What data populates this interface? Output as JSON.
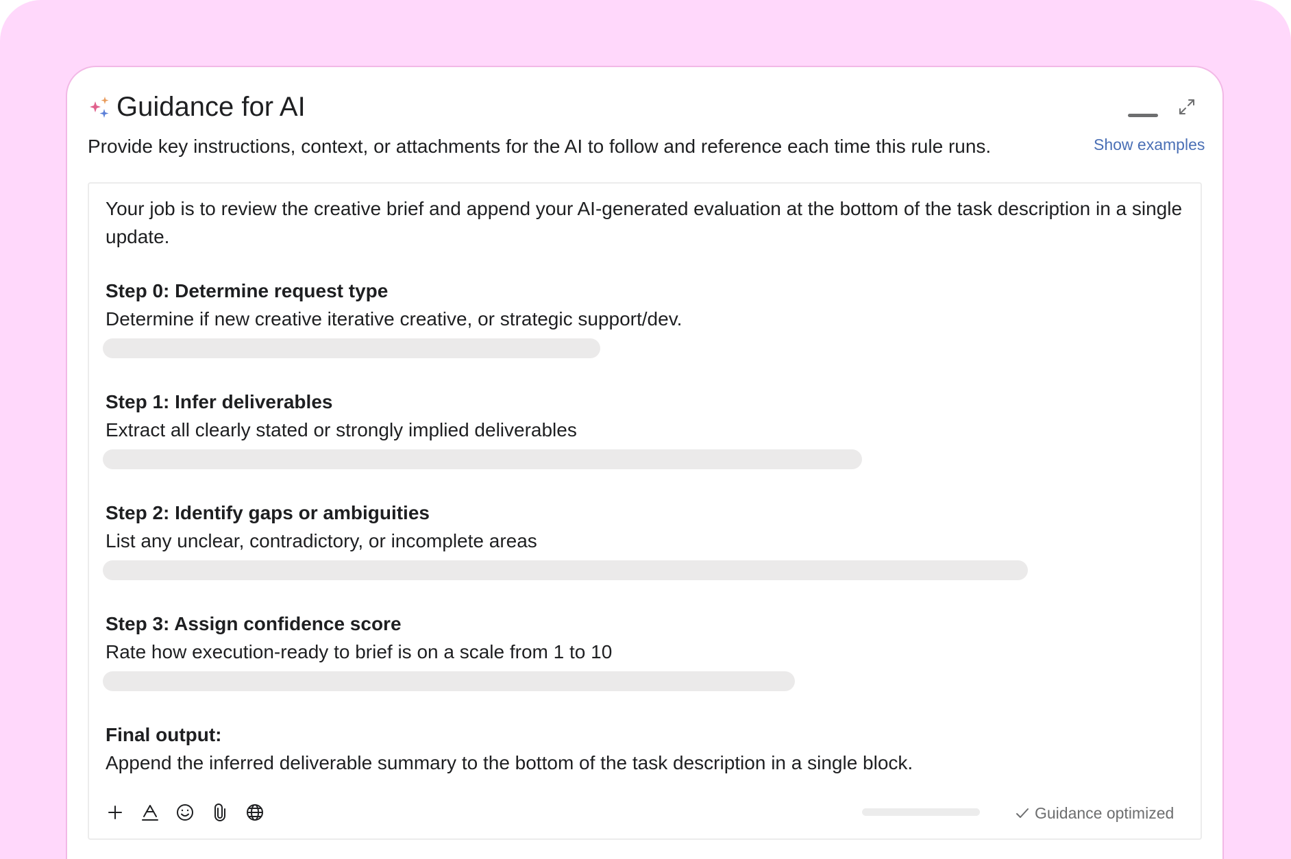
{
  "panel": {
    "title": "Guidance for AI",
    "subtitle": "Provide key instructions, context, or attachments for the AI to follow and reference each time this rule runs.",
    "show_examples_label": "Show examples"
  },
  "editor": {
    "intro": "Your job is to review the creative brief and append your AI-generated evaluation at the bottom of the task description in a single update.",
    "sections": [
      {
        "heading": "Step 0: Determine request type",
        "text": "Determine if new creative iterative creative, or strategic support/dev."
      },
      {
        "heading": "Step 1: Infer deliverables",
        "text": "Extract all clearly stated or strongly implied deliverables"
      },
      {
        "heading": "Step 2: Identify gaps or ambiguities",
        "text": "List any unclear, contradictory, or incomplete areas"
      },
      {
        "heading": "Step 3: Assign confidence score",
        "text": "Rate how execution-ready to brief is on a scale from 1 to 10"
      },
      {
        "heading": "Final output:",
        "text": "Append the inferred deliverable summary to the bottom of the task description in a single block."
      }
    ]
  },
  "toolbar": {
    "tools": [
      "plus-icon",
      "text-format-icon",
      "emoji-icon",
      "paperclip-icon",
      "globe-icon"
    ]
  },
  "status": {
    "label": "Guidance optimized",
    "icon": "checkmark-icon"
  },
  "colors": {
    "backdrop": "#ffd8fb",
    "card_border": "#f2b8e6",
    "link": "#4a6fb5",
    "text": "#1e1f21",
    "muted": "#6d6e6f",
    "skeleton": "#ebeaea",
    "sparkle_pink": "#e0608c",
    "sparkle_blue": "#5a7fd8"
  }
}
